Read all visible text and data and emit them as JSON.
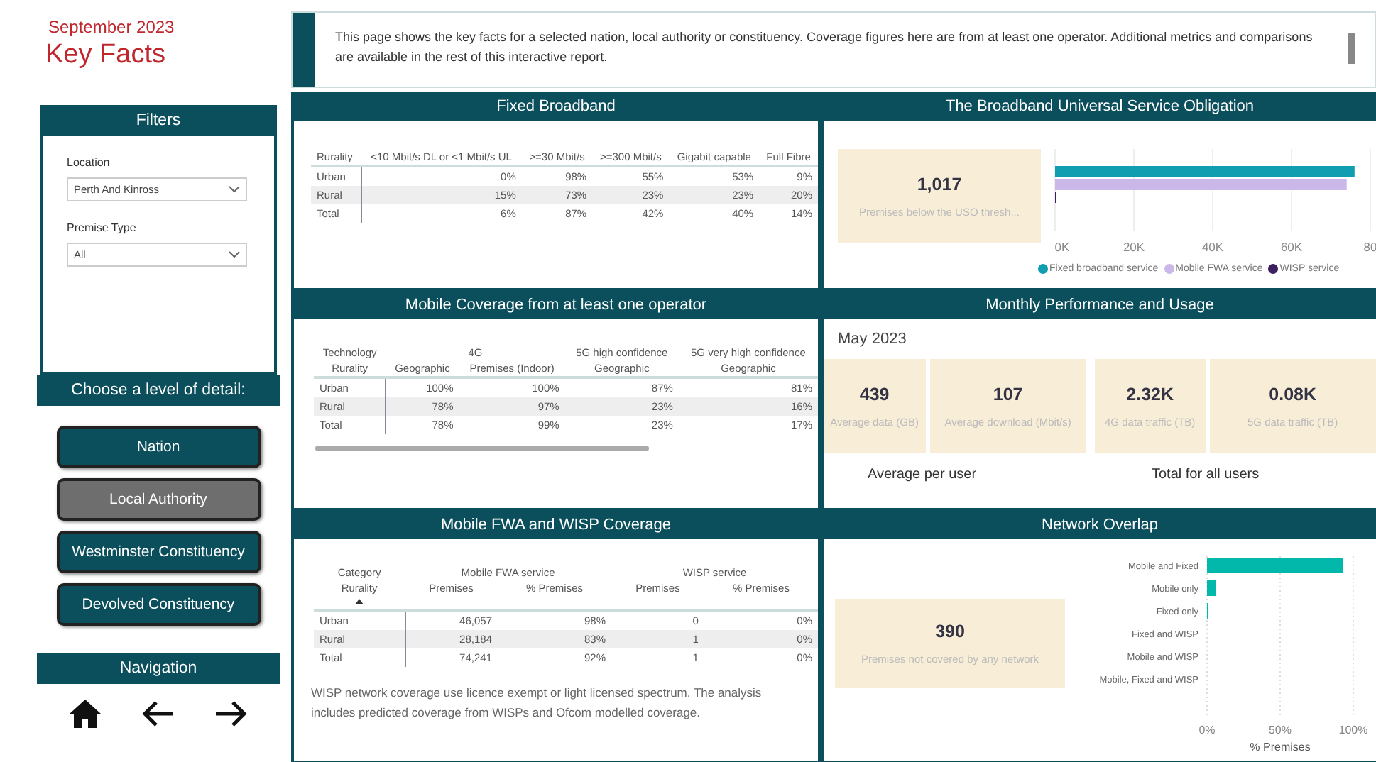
{
  "header": {
    "period": "September 2023",
    "title": "Key Facts"
  },
  "filters": {
    "title": "Filters",
    "fields": [
      {
        "label": "Location",
        "value": "Perth And Kinross"
      },
      {
        "label": "Premise Type",
        "value": "All"
      }
    ]
  },
  "detail": {
    "title": "Choose a level of detail:",
    "options": [
      {
        "label": "Nation",
        "selected": false
      },
      {
        "label": "Local Authority",
        "selected": true
      },
      {
        "label": "Westminster Constituency",
        "selected": false
      },
      {
        "label": "Devolved Constituency",
        "selected": false
      }
    ]
  },
  "navigation": {
    "title": "Navigation"
  },
  "intro": "This page shows the key facts for a selected nation, local authority or constituency. Coverage figures here are from at least one operator. Additional metrics and comparisons are available in the rest of this interactive report.",
  "fixed_broadband": {
    "title": "Fixed Broadband",
    "columns": [
      "Rurality",
      "<10 Mbit/s DL or <1 Mbit/s UL",
      ">=30 Mbit/s",
      ">=300 Mbit/s",
      "Gigabit capable",
      "Full Fibre"
    ],
    "rows": [
      [
        "Urban",
        "0%",
        "98%",
        "55%",
        "53%",
        "9%"
      ],
      [
        "Rural",
        "15%",
        "73%",
        "23%",
        "23%",
        "20%"
      ],
      [
        "Total",
        "6%",
        "87%",
        "42%",
        "40%",
        "14%"
      ]
    ]
  },
  "mobile": {
    "title": "Mobile Coverage from at least one operator",
    "groups": [
      "Technology",
      "4G",
      "5G high confidence",
      "5G very high confidence"
    ],
    "columns": [
      "Rurality",
      "Geographic",
      "Premises (Indoor)",
      "Geographic",
      "Geographic"
    ],
    "rows": [
      [
        "Urban",
        "100%",
        "100%",
        "87%",
        "81%"
      ],
      [
        "Rural",
        "78%",
        "97%",
        "23%",
        "16%"
      ],
      [
        "Total",
        "78%",
        "99%",
        "23%",
        "17%"
      ]
    ]
  },
  "fwa": {
    "title": "Mobile FWA and WISP Coverage",
    "groups": [
      "Category",
      "Mobile FWA service",
      "WISP service"
    ],
    "columns": [
      "Rurality",
      "Premises",
      "% Premises",
      "Premises",
      "% Premises"
    ],
    "rows": [
      [
        "Urban",
        "46,057",
        "98%",
        "0",
        "0%"
      ],
      [
        "Rural",
        "28,184",
        "83%",
        "1",
        "0%"
      ],
      [
        "Total",
        "74,241",
        "92%",
        "1",
        "0%"
      ]
    ],
    "note": "WISP network coverage use licence exempt or light licensed spectrum. The analysis includes predicted coverage from WISPs and Ofcom modelled coverage."
  },
  "uso": {
    "title": "The Broadband Universal Service Obligation",
    "card": {
      "value": "1,017",
      "label": "Premises below the USO thresh..."
    },
    "chart_data": {
      "type": "bar",
      "orientation": "horizontal",
      "grid": true,
      "legend": true,
      "series": [
        {
          "name": "Fixed broadband service",
          "color": "#119eb0",
          "values": [
            76
          ]
        },
        {
          "name": "Mobile FWA service",
          "color": "#c9b8e8",
          "values": [
            74
          ]
        },
        {
          "name": "WISP service",
          "color": "#3b1f5e",
          "values": [
            0
          ]
        }
      ],
      "xlim": [
        0,
        80
      ],
      "xticks": [
        {
          "value": 0,
          "label": "0K"
        },
        {
          "value": 20,
          "label": "20K"
        },
        {
          "value": 40,
          "label": "40K"
        },
        {
          "value": 60,
          "label": "60K"
        },
        {
          "value": 80,
          "label": "80"
        }
      ]
    }
  },
  "monthly": {
    "title": "Monthly Performance and Usage",
    "period": "May  2023",
    "cards": [
      {
        "value": "439",
        "label": "Average data (GB)"
      },
      {
        "value": "107",
        "label": "Average download (Mbit/s)"
      },
      {
        "value": "2.32K",
        "label": "4G data traffic (TB)"
      },
      {
        "value": "0.08K",
        "label": "5G data traffic (TB)"
      }
    ],
    "groups": [
      "Average per user",
      "Total for all users"
    ]
  },
  "overlap": {
    "title": "Network Overlap",
    "card": {
      "value": "390",
      "label": "Premises not covered by any network"
    },
    "chart_data": {
      "type": "bar",
      "orientation": "horizontal",
      "grid": true,
      "categories": [
        "Mobile and Fixed",
        "Mobile only",
        "Fixed only",
        "Fixed and WISP",
        "Mobile and WISP",
        "Mobile, Fixed and WISP"
      ],
      "series": [
        {
          "color": "#01b8aa",
          "values": [
            93,
            6,
            1,
            0,
            0,
            0
          ]
        }
      ],
      "xlabel": "% Premises",
      "xlim": [
        0,
        100
      ],
      "xticks": [
        {
          "value": 0,
          "label": "0%"
        },
        {
          "value": 50,
          "label": "50%"
        },
        {
          "value": 100,
          "label": "100%"
        }
      ]
    }
  }
}
